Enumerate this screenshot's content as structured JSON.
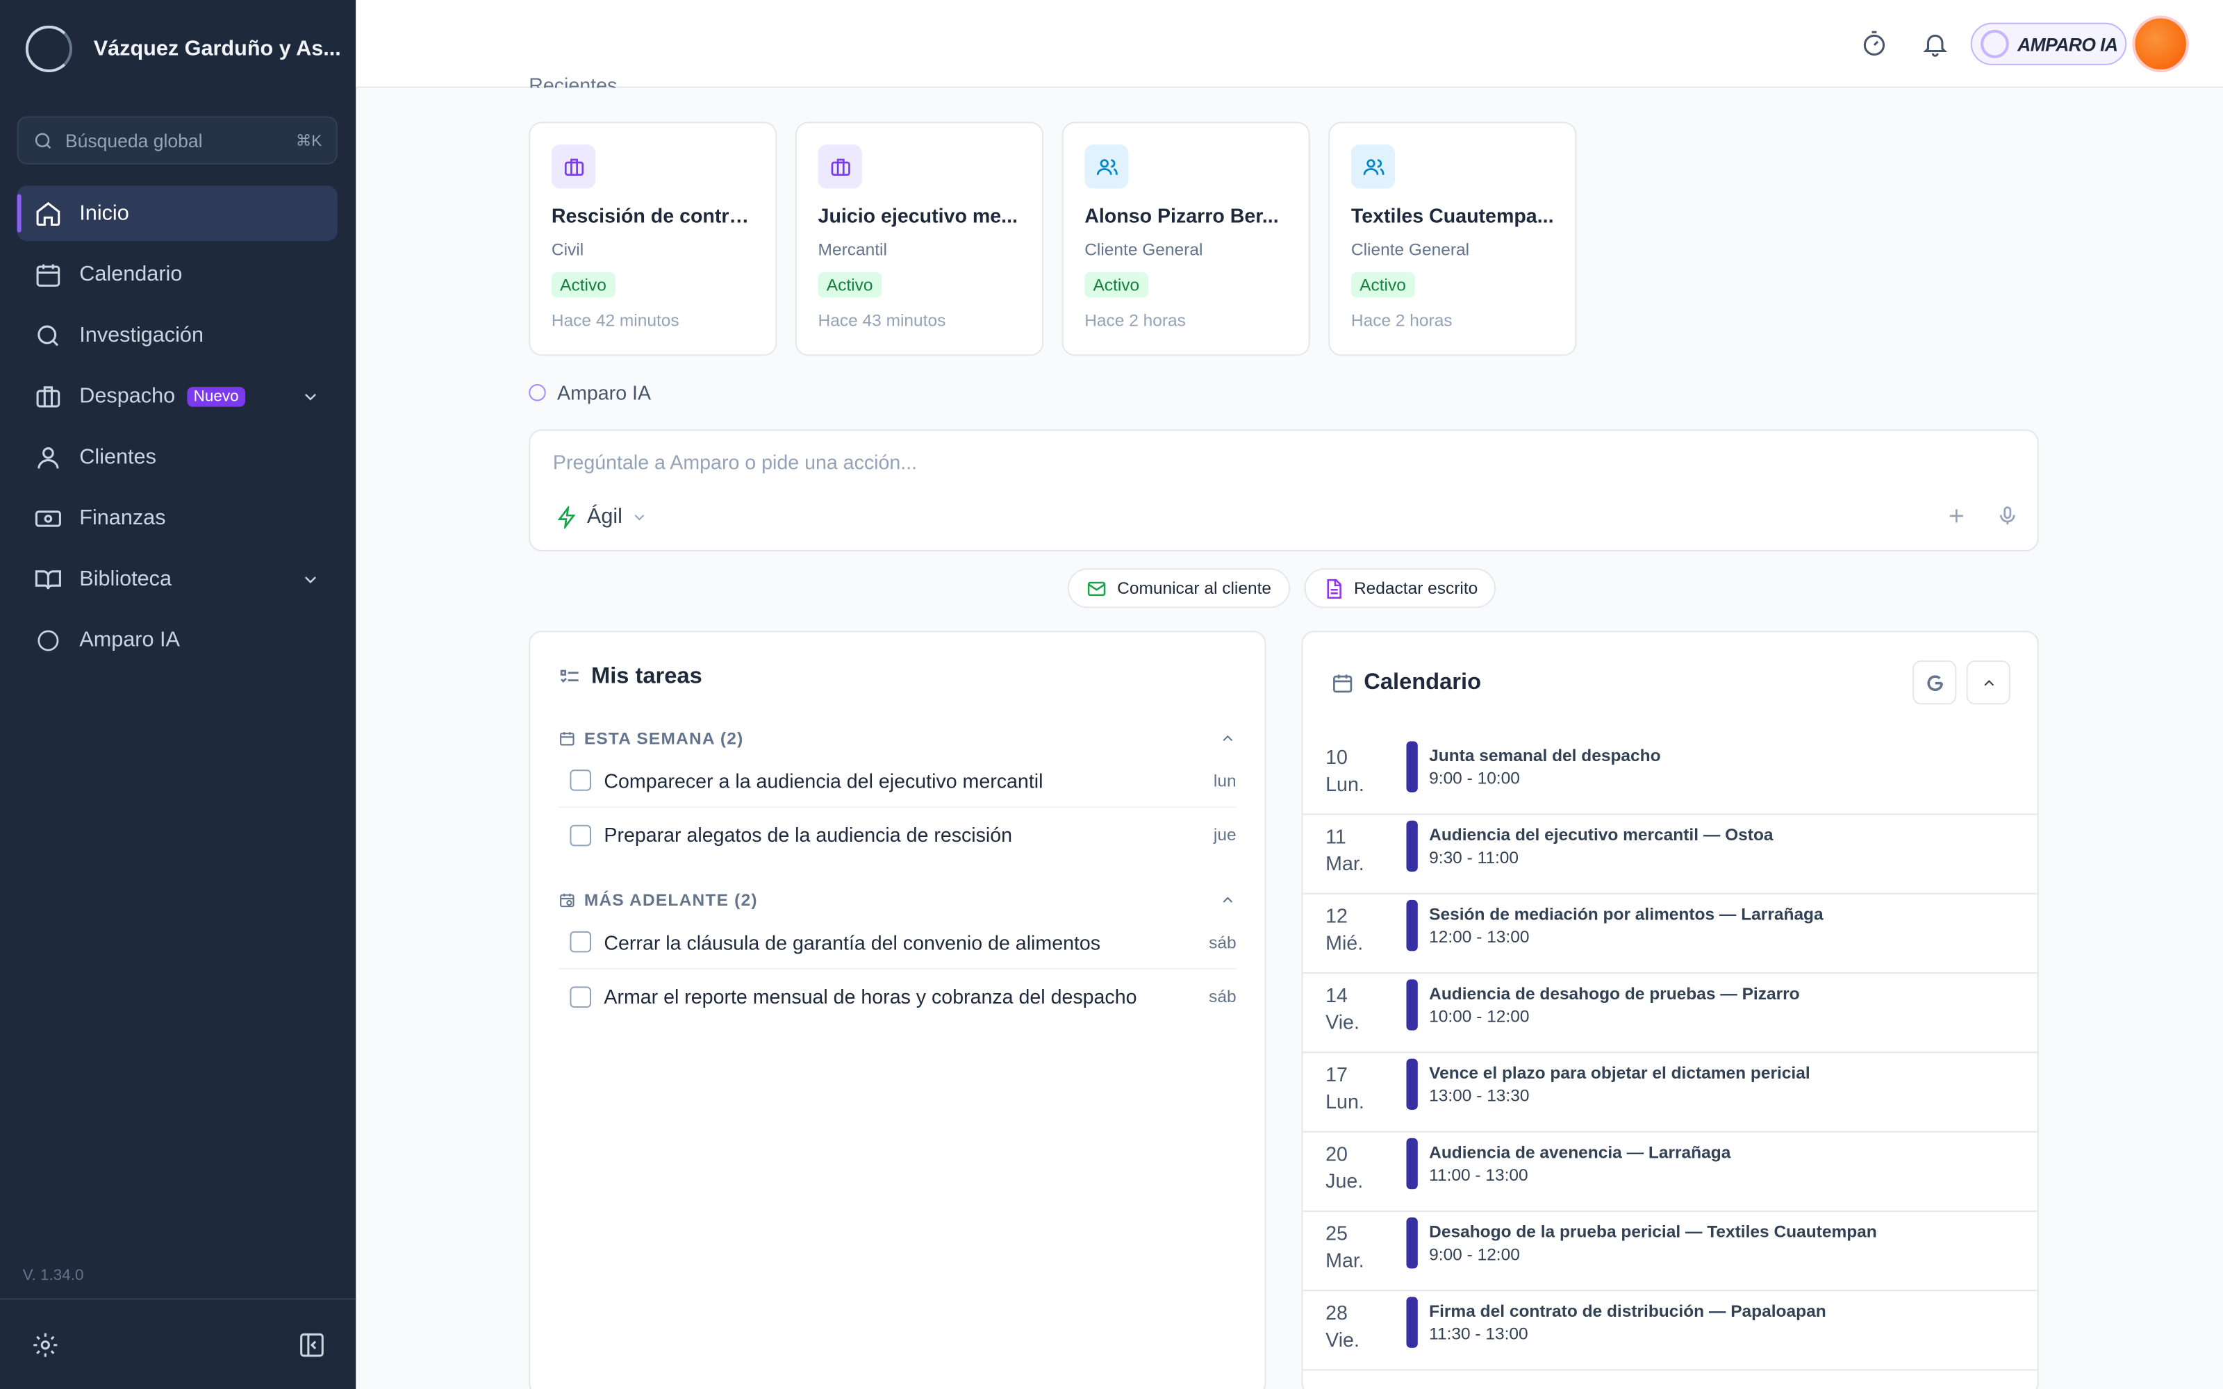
{
  "workspace": {
    "name": "Vázquez Garduño y As..."
  },
  "search": {
    "placeholder": "Búsqueda global",
    "shortcut": "⌘K"
  },
  "sidebar": {
    "items": [
      {
        "label": "Inicio",
        "icon": "home-icon",
        "active": true
      },
      {
        "label": "Calendario",
        "icon": "calendar-icon"
      },
      {
        "label": "Investigación",
        "icon": "search-icon"
      },
      {
        "label": "Despacho",
        "icon": "briefcase-icon",
        "badge": "Nuevo",
        "expandable": true
      },
      {
        "label": "Clientes",
        "icon": "user-icon"
      },
      {
        "label": "Finanzas",
        "icon": "banknote-icon"
      },
      {
        "label": "Biblioteca",
        "icon": "book-icon",
        "expandable": true
      },
      {
        "label": "Amparo IA",
        "icon": "ring-icon"
      }
    ],
    "version": "V. 1.34.0"
  },
  "topbar": {
    "assistant_label": "AMPARO IA"
  },
  "recents": {
    "label": "Recientes",
    "cards": [
      {
        "title": "Rescisión de contra...",
        "subtitle": "Civil",
        "status": "Activo",
        "time": "Hace 42 minutos",
        "icon": "briefcase-icon",
        "tone": "purple"
      },
      {
        "title": "Juicio ejecutivo me...",
        "subtitle": "Mercantil",
        "status": "Activo",
        "time": "Hace 43 minutos",
        "icon": "briefcase-icon",
        "tone": "purple"
      },
      {
        "title": "Alonso Pizarro Ber...",
        "subtitle": "Cliente General",
        "status": "Activo",
        "time": "Hace 2 horas",
        "icon": "users-icon",
        "tone": "blue"
      },
      {
        "title": "Textiles Cuautempa...",
        "subtitle": "Cliente General",
        "status": "Activo",
        "time": "Hace 2 horas",
        "icon": "users-icon",
        "tone": "blue"
      }
    ]
  },
  "ai": {
    "label": "Amparo IA",
    "placeholder": "Pregúntale a Amparo o pide una acción...",
    "mode": "Ágil",
    "quick_actions": [
      "Comunicar al cliente",
      "Redactar escrito"
    ]
  },
  "tasks": {
    "title": "Mis tareas",
    "sections": [
      {
        "label": "ESTA SEMANA (2)",
        "items": [
          {
            "text": "Comparecer a la audiencia del ejecutivo mercantil",
            "day": "lun"
          },
          {
            "text": "Preparar alegatos de la audiencia de rescisión",
            "day": "jue"
          }
        ]
      },
      {
        "label": "MÁS ADELANTE (2)",
        "items": [
          {
            "text": "Cerrar la cláusula de garantía del convenio de alimentos",
            "day": "sáb"
          },
          {
            "text": "Armar el reporte mensual de horas y cobranza del despacho",
            "day": "sáb"
          }
        ]
      }
    ]
  },
  "calendar": {
    "title": "Calendario",
    "events": [
      {
        "day": "10",
        "weekday": "Lun.",
        "title": "Junta semanal del despacho",
        "time": "9:00 - 10:00"
      },
      {
        "day": "11",
        "weekday": "Mar.",
        "title": "Audiencia del ejecutivo mercantil — Ostoa",
        "time": "9:30 - 11:00"
      },
      {
        "day": "12",
        "weekday": "Mié.",
        "title": "Sesión de mediación por alimentos — Larrañaga",
        "time": "12:00 - 13:00"
      },
      {
        "day": "14",
        "weekday": "Vie.",
        "title": "Audiencia de desahogo de pruebas — Pizarro",
        "time": "10:00 - 12:00"
      },
      {
        "day": "17",
        "weekday": "Lun.",
        "title": "Vence el plazo para objetar el dictamen pericial",
        "time": "13:00 - 13:30"
      },
      {
        "day": "20",
        "weekday": "Jue.",
        "title": "Audiencia de avenencia — Larrañaga",
        "time": "11:00 - 13:00"
      },
      {
        "day": "25",
        "weekday": "Mar.",
        "title": "Desahogo de la prueba pericial — Textiles Cuautempan",
        "time": "9:00 - 12:00"
      },
      {
        "day": "28",
        "weekday": "Vie.",
        "title": "Firma del contrato de distribución — Papaloapan",
        "time": "11:30 - 13:00"
      }
    ]
  },
  "colors": {
    "sidebar": "#1e293b",
    "accent": "#7c3aed",
    "event_bar": "#3730a3",
    "status_bg": "#dcfce7",
    "status_fg": "#15803d"
  }
}
